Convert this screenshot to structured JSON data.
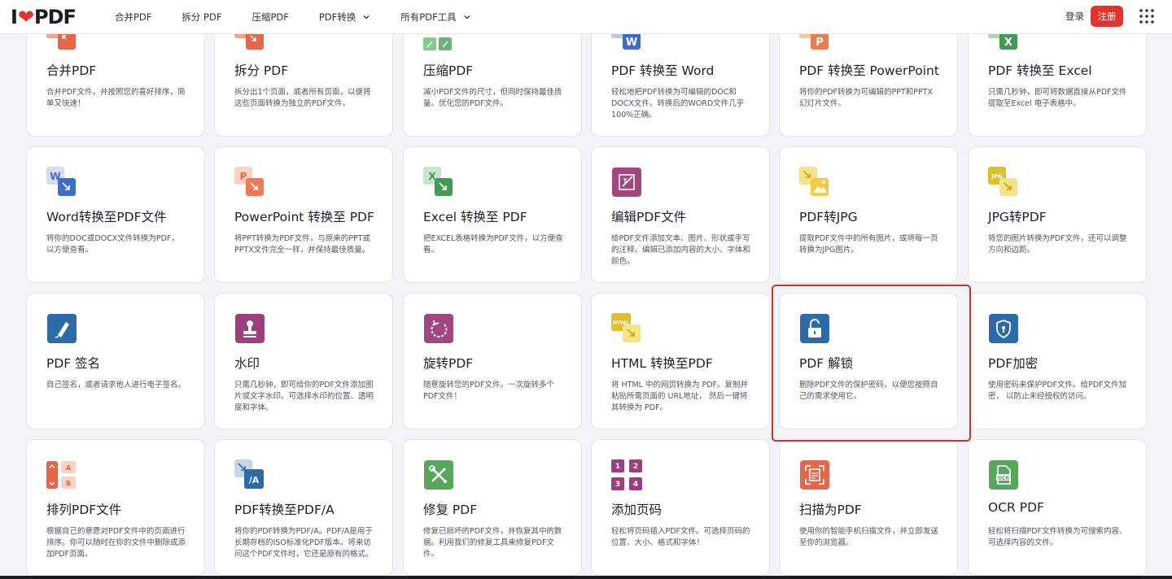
{
  "header": {
    "logo_text_left": "I",
    "logo_text_right": "PDF",
    "nav": [
      {
        "label": "合并PDF",
        "dropdown": false
      },
      {
        "label": "拆分 PDF",
        "dropdown": false
      },
      {
        "label": "压缩PDF",
        "dropdown": false
      },
      {
        "label": "PDF转换",
        "dropdown": true
      },
      {
        "label": "所有PDF工具",
        "dropdown": true
      }
    ],
    "login_label": "登录",
    "signup_label": "注册"
  },
  "colors": {
    "brand_red": "#e5322d",
    "highlight": "#d32f2f"
  },
  "tools": [
    {
      "title": "合并PDF",
      "desc": "合并PDF文件，并按照您的喜好排序，简单又快速！",
      "icon": "merge-icon"
    },
    {
      "title": "拆分 PDF",
      "desc": "拆分出1个页面，或者所有页面，以便将这些页面转换为独立的PDF文件。",
      "icon": "split-icon"
    },
    {
      "title": "压缩PDF",
      "desc": "减小PDF文件的尺寸，但同时保持最佳质量。优化您的PDF文件。",
      "icon": "compress-icon"
    },
    {
      "title": "PDF 转换至 Word",
      "desc": "轻松地把PDF转换为可编辑的DOC和DOCX文件。转换后的WORD文件几乎100%正确。",
      "icon": "pdf-to-word-icon"
    },
    {
      "title": "PDF 转换至 PowerPoint",
      "desc": "将你的PDF转换为可编辑的PPT和PPTX幻灯片文件。",
      "icon": "pdf-to-powerpoint-icon"
    },
    {
      "title": "PDF 转换至 Excel",
      "desc": "只需几秒钟，即可将数据直接从PDF文件提取至Excel 电子表格中。",
      "icon": "pdf-to-excel-icon"
    },
    {
      "title": "Word转换至PDF文件",
      "desc": "将你的DOC或DOCX文件转换为PDF，以方便查看。",
      "icon": "word-to-pdf-icon"
    },
    {
      "title": "PowerPoint 转换至 PDF",
      "desc": "将PPT转换为PDF文件，与原来的PPT或PPTX文件完全一样，并保持最佳质量。",
      "icon": "powerpoint-to-pdf-icon"
    },
    {
      "title": "Excel 转换至 PDF",
      "desc": "把EXCEL表格转换为PDF文件，以方便查看。",
      "icon": "excel-to-pdf-icon"
    },
    {
      "title": "编辑PDF文件",
      "desc": "给PDF文件添加文本、图片、形状或手写的注释。编辑已添加内容的大小、字体和颜色。",
      "icon": "edit-pdf-icon"
    },
    {
      "title": "PDF转JPG",
      "desc": "提取PDF文件中的所有图片，或将每一页转换为JPG图片。",
      "icon": "pdf-to-jpg-icon"
    },
    {
      "title": "JPG转PDF",
      "desc": "将您的图片转换为PDF文件，还可以调整方向和边距。",
      "icon": "jpg-to-pdf-icon"
    },
    {
      "title": "PDF 签名",
      "desc": "自己签名，或者请求他人进行电子签名。",
      "icon": "sign-pdf-icon"
    },
    {
      "title": "水印",
      "desc": "只需几秒钟，即可给你的PDF文件添加图片或文字水印。可选择水印的位置、透明度和字体。",
      "icon": "watermark-icon"
    },
    {
      "title": "旋转PDF",
      "desc": "随意旋转您的PDF文件。一次旋转多个PDF文件！",
      "icon": "rotate-pdf-icon"
    },
    {
      "title": "HTML 转换至PDF",
      "desc": "将 HTML 中的网页转换为 PDF。复制并粘贴所需页面的 URL地址， 然后一键将其转换为 PDF。",
      "icon": "html-to-pdf-icon"
    },
    {
      "title": "PDF 解锁",
      "desc": "删除PDF文件的保护密码，以便您按照自己的需求使用它。",
      "icon": "unlock-pdf-icon"
    },
    {
      "title": "PDF加密",
      "desc": "使用密码来保护PDF文件。给PDF文件加密， 以防止未经授权的访问。",
      "icon": "protect-pdf-icon"
    },
    {
      "title": "排列PDF文件",
      "desc": "根据自己的意愿对PDF文件中的页面进行排序。你可以随时在你的文件中删除或添加PDF页面。",
      "icon": "organize-pdf-icon"
    },
    {
      "title": "PDF转换至PDF/A",
      "desc": "将你的PDF转换为PDF/A。PDF/A是用于长期存档的ISO标准化PDF版本。将来访问这个PDF文件时，它还是原有的格式。",
      "icon": "pdf-to-pdfa-icon"
    },
    {
      "title": "修复 PDF",
      "desc": "修复已损坏的PDF文件，并恢复其中的数据。利用我们的修复工具来修复PDF文件。",
      "icon": "repair-pdf-icon"
    },
    {
      "title": "添加页码",
      "desc": "轻松将页码插入PDF文件。可选择页码的位置、大小、格式和字体！",
      "icon": "page-numbers-icon"
    },
    {
      "title": "扫描为PDF",
      "desc": "使用你的智能手机扫描文件，并立即发送至你的浏览器。",
      "icon": "scan-to-pdf-icon"
    },
    {
      "title": "OCR PDF",
      "desc": "轻松将扫描PDF文件转换为可搜索内容、可选择内容的文件。",
      "icon": "ocr-pdf-icon"
    }
  ]
}
